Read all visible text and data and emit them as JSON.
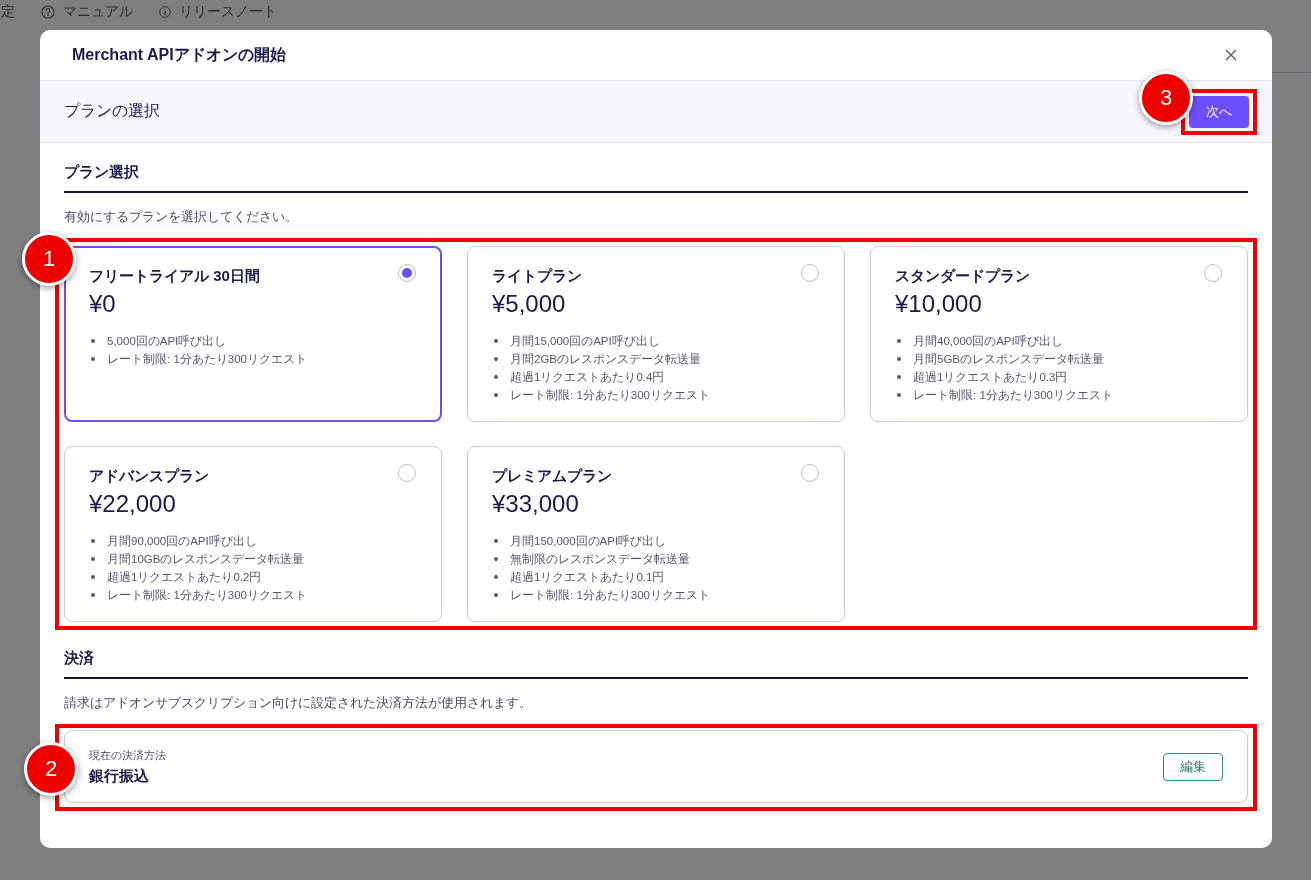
{
  "background_nav": [
    {
      "label": "定"
    },
    {
      "label": "マニュアル"
    },
    {
      "label": "リリースノート"
    }
  ],
  "dialog": {
    "title": "Merchant APIアドオンの開始",
    "step": "プランの選択",
    "next_button": "次へ"
  },
  "plan_section": {
    "title": "プラン選択",
    "description": "有効にするプランを選択してください。",
    "plans": [
      {
        "name": "フリートライアル 30日間",
        "price": "¥0",
        "selected": true,
        "features": [
          "5,000回のAPI呼び出し",
          "レート制限: 1分あたり300リクエスト"
        ]
      },
      {
        "name": "ライトプラン",
        "price": "¥5,000",
        "selected": false,
        "features": [
          "月間15,000回のAPI呼び出し",
          "月間2GBのレスポンスデータ転送量",
          "超過1リクエストあたり0.4円",
          "レート制限: 1分あたり300リクエスト"
        ]
      },
      {
        "name": "スタンダードプラン",
        "price": "¥10,000",
        "selected": false,
        "features": [
          "月間40,000回のAPI呼び出し",
          "月間5GBのレスポンスデータ転送量",
          "超過1リクエストあたり0.3円",
          "レート制限: 1分あたり300リクエスト"
        ]
      },
      {
        "name": "アドバンスプラン",
        "price": "¥22,000",
        "selected": false,
        "features": [
          "月間90,000回のAPI呼び出し",
          "月間10GBのレスポンスデータ転送量",
          "超過1リクエストあたり0.2円",
          "レート制限: 1分あたり300リクエスト"
        ]
      },
      {
        "name": "プレミアムプラン",
        "price": "¥33,000",
        "selected": false,
        "features": [
          "月間150,000回のAPI呼び出し",
          "無制限のレスポンスデータ転送量",
          "超過1リクエストあたり0.1円",
          "レート制限: 1分あたり300リクエスト"
        ]
      }
    ]
  },
  "payment_section": {
    "title": "決済",
    "description": "請求はアドオンサブスクリプション向けに設定された決済方法が使用されます。",
    "card": {
      "label": "現在の決済方法",
      "value": "銀行振込",
      "edit_button": "編集"
    }
  },
  "callouts": [
    {
      "number": "1"
    },
    {
      "number": "2"
    },
    {
      "number": "3"
    }
  ]
}
